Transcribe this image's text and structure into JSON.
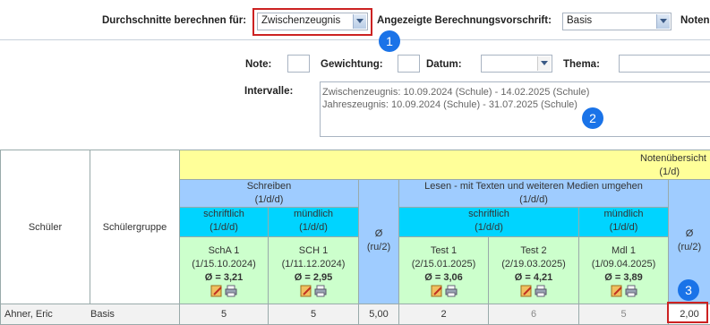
{
  "toolbar": {
    "average_label": "Durchschnitte berechnen für:",
    "average_value": "Zwischenzeugnis",
    "rule_label": "Angezeigte Berechnungsvorschrift:",
    "rule_value": "Basis",
    "grades_label": "Noten"
  },
  "filters": {
    "note_label": "Note:",
    "weight_label": "Gewichtung:",
    "date_label": "Datum:",
    "topic_label": "Thema:",
    "intervals_label": "Intervalle:",
    "intervals": [
      "Zwischenzeugnis: 10.09.2024 (Schule) - 14.02.2025 (Schule)",
      "Jahreszeugnis: 10.09.2024 (Schule) - 31.07.2025 (Schule)"
    ]
  },
  "badges": {
    "b1": "1",
    "b2": "2",
    "b3": "3"
  },
  "table": {
    "col_student": "Schüler",
    "col_group": "Schülergruppe",
    "overview": "Notenübersicht",
    "overview_sub": "(1/d)",
    "subject1": "Schreiben",
    "subject1_sub": "(1/d/d)",
    "subject1_avg": "Ø",
    "subject1_avg_sub": "(ru/2)",
    "s1_written": "schriftlich",
    "s1_written_sub": "(1/d/d)",
    "s1_oral": "mündlich",
    "s1_oral_sub": "(1/d/d)",
    "subject2": "Lesen - mit Texten und weiteren Medien umgehen",
    "subject2_sub": "(1/d/d)",
    "subject2_avg": "Ø",
    "subject2_avg_sub": "(ru/2)",
    "s2_written": "schriftlich",
    "s2_written_sub": "(1/d/d)",
    "s2_oral": "mündlich",
    "s2_oral_sub": "(1/d/d)",
    "exams": [
      {
        "name": "SchA 1",
        "meta": "(1/15.10.2024)",
        "avg": "Ø = 3,21"
      },
      {
        "name": "SCH 1",
        "meta": "(1/11.12.2024)",
        "avg": "Ø = 2,95"
      },
      {
        "name": "Test 1",
        "meta": "(2/15.01.2025)",
        "avg": "Ø = 3,06"
      },
      {
        "name": "Test 2",
        "meta": "(2/19.03.2025)",
        "avg": "Ø = 4,21"
      },
      {
        "name": "Mdl 1",
        "meta": "(1/09.04.2025)",
        "avg": "Ø = 3,89"
      }
    ],
    "row": {
      "student": "Ahner, Eric",
      "group": "Basis",
      "g1": "5",
      "g2": "5",
      "avg1": "5,00",
      "g3": "2",
      "g4": "6",
      "g5": "5",
      "avg2": "2,00"
    }
  }
}
